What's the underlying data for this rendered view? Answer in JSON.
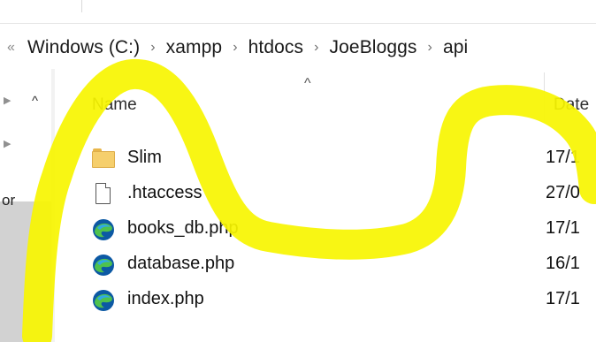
{
  "breadcrumb": {
    "lead": "«",
    "items": [
      "Windows (C:)",
      "xampp",
      "htdocs",
      "JoeBloggs",
      "api"
    ],
    "separator": "›"
  },
  "nav_pane": {
    "partial_label": "or"
  },
  "columns": {
    "name": "Name",
    "date": "Date"
  },
  "files": [
    {
      "name": "Slim",
      "icon": "folder-icon",
      "date": "17/1"
    },
    {
      "name": ".htaccess",
      "icon": "file-icon",
      "date": "27/0"
    },
    {
      "name": "books_db.php",
      "icon": "edge-icon",
      "date": "17/1"
    },
    {
      "name": "database.php",
      "icon": "edge-icon",
      "date": "16/1"
    },
    {
      "name": "index.php",
      "icon": "edge-icon",
      "date": "17/1"
    }
  ],
  "colors": {
    "highlight_scribble": "#f7f500",
    "folder": "#f6cf6c",
    "edge_blue": "#0c59a4",
    "edge_green": "#4fc24d"
  }
}
